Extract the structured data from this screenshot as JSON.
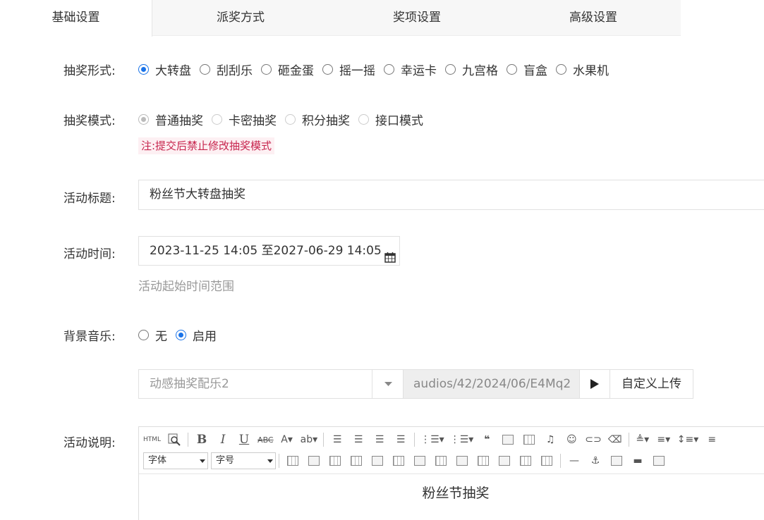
{
  "tabs": [
    {
      "label": "基础设置",
      "active": true
    },
    {
      "label": "派奖方式",
      "active": false
    },
    {
      "label": "奖项设置",
      "active": false
    },
    {
      "label": "高级设置",
      "active": false
    }
  ],
  "lottery_form": {
    "label": "抽奖形式:",
    "options": [
      "大转盘",
      "刮刮乐",
      "砸金蛋",
      "摇一摇",
      "幸运卡",
      "九宫格",
      "盲盒",
      "水果机"
    ],
    "selected": "大转盘"
  },
  "lottery_mode": {
    "label": "抽奖模式:",
    "options": [
      "普通抽奖",
      "卡密抽奖",
      "积分抽奖",
      "接口模式"
    ],
    "selected": "普通抽奖",
    "note": "注:提交后禁止修改抽奖模式"
  },
  "activity_title": {
    "label": "活动标题:",
    "value": "粉丝节大转盘抽奖"
  },
  "activity_time": {
    "label": "活动时间:",
    "value": "2023-11-25 14:05 至2027-06-29 14:05",
    "help": "活动起始时间范围"
  },
  "bg_music": {
    "label": "背景音乐:",
    "options": [
      "无",
      "启用"
    ],
    "selected": "启用",
    "track": "动感抽奖配乐2",
    "path": "audios/42/2024/06/E4Mq2",
    "upload_label": "自定义上传"
  },
  "activity_desc": {
    "label": "活动说明:",
    "font_select": "字体",
    "size_select": "字号",
    "content": "粉丝节抽奖"
  },
  "colors": {
    "accent": "#1a73e8",
    "warning": "#c7254e"
  }
}
